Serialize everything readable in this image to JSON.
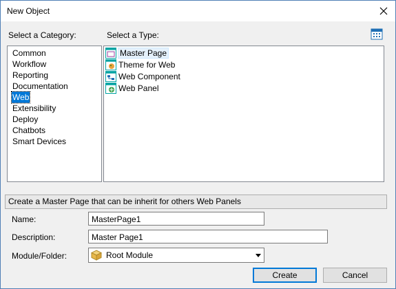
{
  "window": {
    "title": "New Object"
  },
  "category": {
    "label": "Select a Category:",
    "items": [
      "Common",
      "Workflow",
      "Reporting",
      "Documentation",
      "Web",
      "Extensibility",
      "Deploy",
      "Chatbots",
      "Smart Devices"
    ],
    "selected": "Web"
  },
  "type": {
    "label": "Select a Type:",
    "items": [
      {
        "label": "Master Page",
        "icon": "master-page-icon"
      },
      {
        "label": "Theme for Web",
        "icon": "theme-icon"
      },
      {
        "label": "Web Component",
        "icon": "web-component-icon"
      },
      {
        "label": "Web Panel",
        "icon": "web-panel-icon"
      }
    ],
    "selected": "Master Page"
  },
  "description_text": "Create a Master Page that can be inherit for others Web Panels",
  "form": {
    "name_label": "Name:",
    "name_value": "MasterPage1",
    "description_label": "Description:",
    "description_value": "Master Page1",
    "module_label": "Module/Folder:",
    "module_value": "Root Module"
  },
  "buttons": {
    "create": "Create",
    "cancel": "Cancel"
  },
  "colors": {
    "selection": "#0078d7",
    "accent": "#00a3a3"
  }
}
